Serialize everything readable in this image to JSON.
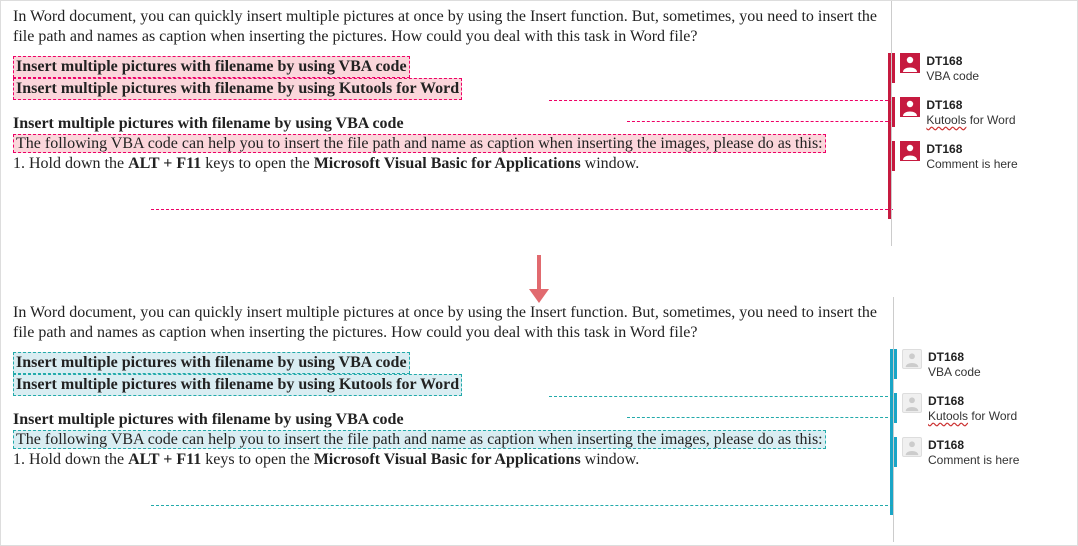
{
  "intro": "In Word document, you can quickly insert multiple pictures at once by using the Insert function. But, sometimes, you need to insert the file path and names as caption when inserting the pictures. How could you deal with this task in Word file?",
  "link1": "Insert multiple pictures with filename by using VBA code",
  "link2": "Insert multiple pictures with filename by using Kutools for Word",
  "section_head": "Insert multiple pictures with filename by using VBA code",
  "body_text": "The following VBA code can help you to insert the file path and name as caption when inserting the images, please do as this:",
  "step1_prefix": "1. Hold down the ",
  "step1_keys": "ALT + F11",
  "step1_mid": " keys to open the ",
  "step1_app": "Microsoft Visual Basic for Applications",
  "step1_suffix": " window.",
  "comments": [
    {
      "author": "DT168",
      "text_plain": "VBA code",
      "text_wavy": ""
    },
    {
      "author": "DT168",
      "text_wavy": "Kutools",
      "text_plain": " for Word"
    },
    {
      "author": "DT168",
      "text_plain": "Comment is here",
      "text_wavy": ""
    }
  ]
}
